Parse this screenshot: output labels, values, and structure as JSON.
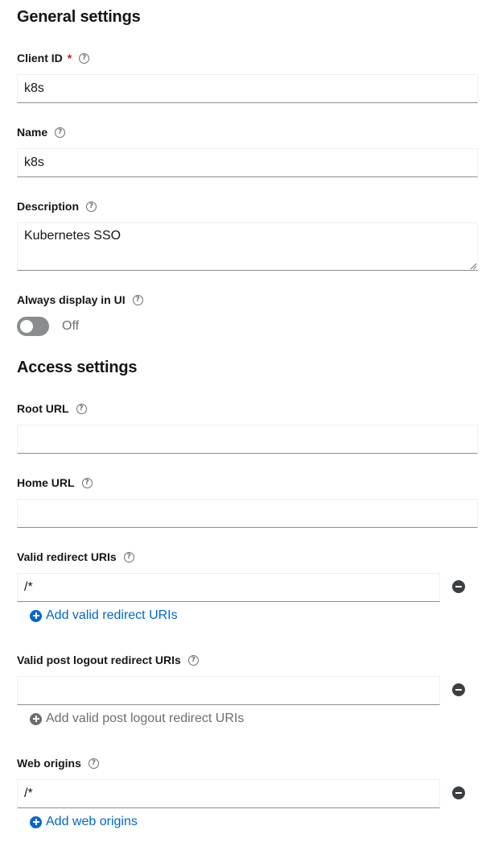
{
  "general": {
    "title": "General settings",
    "client_id": {
      "label": "Client ID",
      "required_mark": "*",
      "value": "k8s"
    },
    "name": {
      "label": "Name",
      "value": "k8s"
    },
    "description": {
      "label": "Description",
      "value": "Kubernetes SSO"
    },
    "always_display": {
      "label": "Always display in UI",
      "state_label": "Off",
      "on": false
    }
  },
  "access": {
    "title": "Access settings",
    "root_url": {
      "label": "Root URL",
      "value": ""
    },
    "home_url": {
      "label": "Home URL",
      "value": ""
    },
    "redirect_uris": {
      "label": "Valid redirect URIs",
      "value": "/*",
      "add_label": "Add valid redirect URIs"
    },
    "post_logout": {
      "label": "Valid post logout redirect URIs",
      "value": "",
      "add_label": "Add valid post logout redirect URIs"
    },
    "web_origins": {
      "label": "Web origins",
      "value": "/*",
      "add_label": "Add web origins"
    }
  },
  "help_glyph": "?",
  "colors": {
    "link": "#0066cc",
    "required": "#c9190b",
    "muted": "#6a6e73",
    "toggle_off": "#8a8d90"
  },
  "icons": [
    "help-icon",
    "remove-icon",
    "plus-circle-icon"
  ]
}
